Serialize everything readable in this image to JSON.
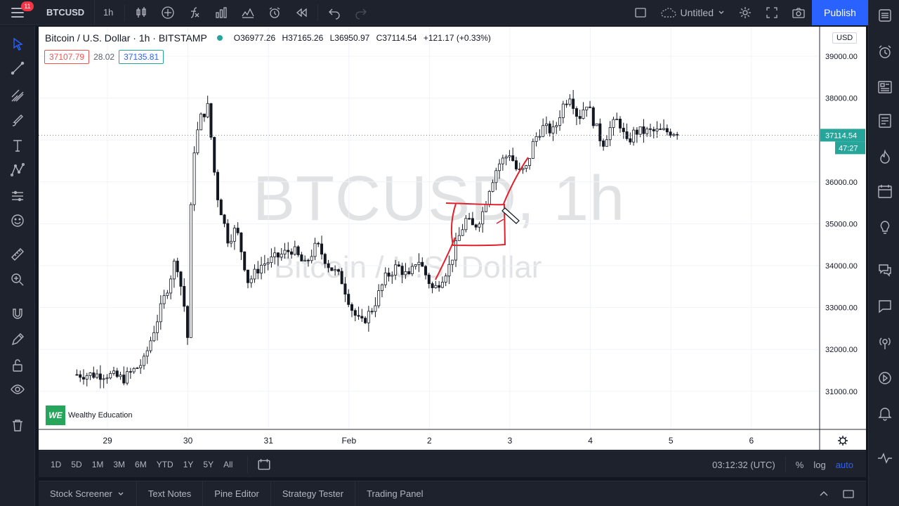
{
  "topbar": {
    "notification_count": "11",
    "symbol": "BTCUSD",
    "interval": "1h",
    "layout_name": "Untitled",
    "publish_label": "Publish"
  },
  "chart": {
    "title": "Bitcoin / U.S. Dollar · 1h · BITSTAMP",
    "ohlc": {
      "open": "O36977.26",
      "high": "H37165.26",
      "low": "L36950.97",
      "close": "C37114.54",
      "change": "+121.17 (+0.33%)"
    },
    "bid": "37107.79",
    "spread": "28.02",
    "ask": "37135.81",
    "currency": "USD",
    "watermark_main": "BTCUSD, 1h",
    "watermark_sub": "Bitcoin / U.S. Dollar",
    "brand": "Wealthy Education",
    "brand_logo": "WE",
    "last_price": "37114.54",
    "countdown": "47:27"
  },
  "colors": {
    "up": "#26a69a",
    "down": "#ef5350",
    "accent": "#2962ff",
    "annotation": "#e0202c"
  },
  "chart_data": {
    "type": "candlestick",
    "y_ticks": [
      "39000.00",
      "38000.00",
      "36000.00",
      "35000.00",
      "34000.00",
      "33000.00",
      "32000.00",
      "31000.00"
    ],
    "x_ticks": [
      "29",
      "30",
      "31",
      "Feb",
      "2",
      "3",
      "4",
      "5",
      "6"
    ],
    "ylim": [
      30100,
      39500
    ],
    "last_price": 37114.54,
    "grid": true,
    "close_path": [
      [
        0,
        31400
      ],
      [
        0.2,
        31300
      ],
      [
        0.45,
        31700
      ],
      [
        0.6,
        32600
      ],
      [
        0.75,
        33500
      ],
      [
        0.85,
        34200
      ],
      [
        0.95,
        33100
      ],
      [
        1.0,
        32200
      ],
      [
        1.05,
        36500
      ],
      [
        1.15,
        37500
      ],
      [
        1.25,
        37800
      ],
      [
        1.35,
        35800
      ],
      [
        1.5,
        34600
      ],
      [
        1.6,
        34900
      ],
      [
        1.75,
        33600
      ],
      [
        1.9,
        34000
      ],
      [
        2.1,
        34200
      ],
      [
        2.3,
        34400
      ],
      [
        2.45,
        34000
      ],
      [
        2.6,
        34500
      ],
      [
        2.75,
        34000
      ],
      [
        2.9,
        33700
      ],
      [
        3.05,
        32900
      ],
      [
        3.15,
        32600
      ],
      [
        3.3,
        33000
      ],
      [
        3.45,
        33700
      ],
      [
        3.6,
        34000
      ],
      [
        3.75,
        33700
      ],
      [
        3.85,
        34200
      ],
      [
        3.95,
        33800
      ],
      [
        4.05,
        33400
      ],
      [
        4.15,
        33700
      ],
      [
        4.25,
        34000
      ],
      [
        4.35,
        34600
      ],
      [
        4.45,
        35100
      ],
      [
        4.55,
        34900
      ],
      [
        4.65,
        35200
      ],
      [
        4.75,
        35900
      ],
      [
        4.85,
        36400
      ],
      [
        5.0,
        36700
      ],
      [
        5.1,
        36200
      ],
      [
        5.2,
        36300
      ],
      [
        5.3,
        37000
      ],
      [
        5.4,
        37300
      ],
      [
        5.55,
        37200
      ],
      [
        5.65,
        37800
      ],
      [
        5.75,
        38100
      ],
      [
        5.85,
        37500
      ],
      [
        5.95,
        37900
      ],
      [
        6.05,
        37400
      ],
      [
        6.15,
        36900
      ],
      [
        6.25,
        37300
      ],
      [
        6.35,
        37500
      ],
      [
        6.45,
        36900
      ],
      [
        6.55,
        37200
      ]
    ]
  },
  "ranges": [
    "1D",
    "5D",
    "1M",
    "3M",
    "6M",
    "YTD",
    "1Y",
    "5Y",
    "All"
  ],
  "statusbar": {
    "time": "03:12:32 (UTC)",
    "percent": "%",
    "log": "log",
    "auto": "auto"
  },
  "panels": [
    "Stock Screener",
    "Text Notes",
    "Pine Editor",
    "Strategy Tester",
    "Trading Panel"
  ]
}
